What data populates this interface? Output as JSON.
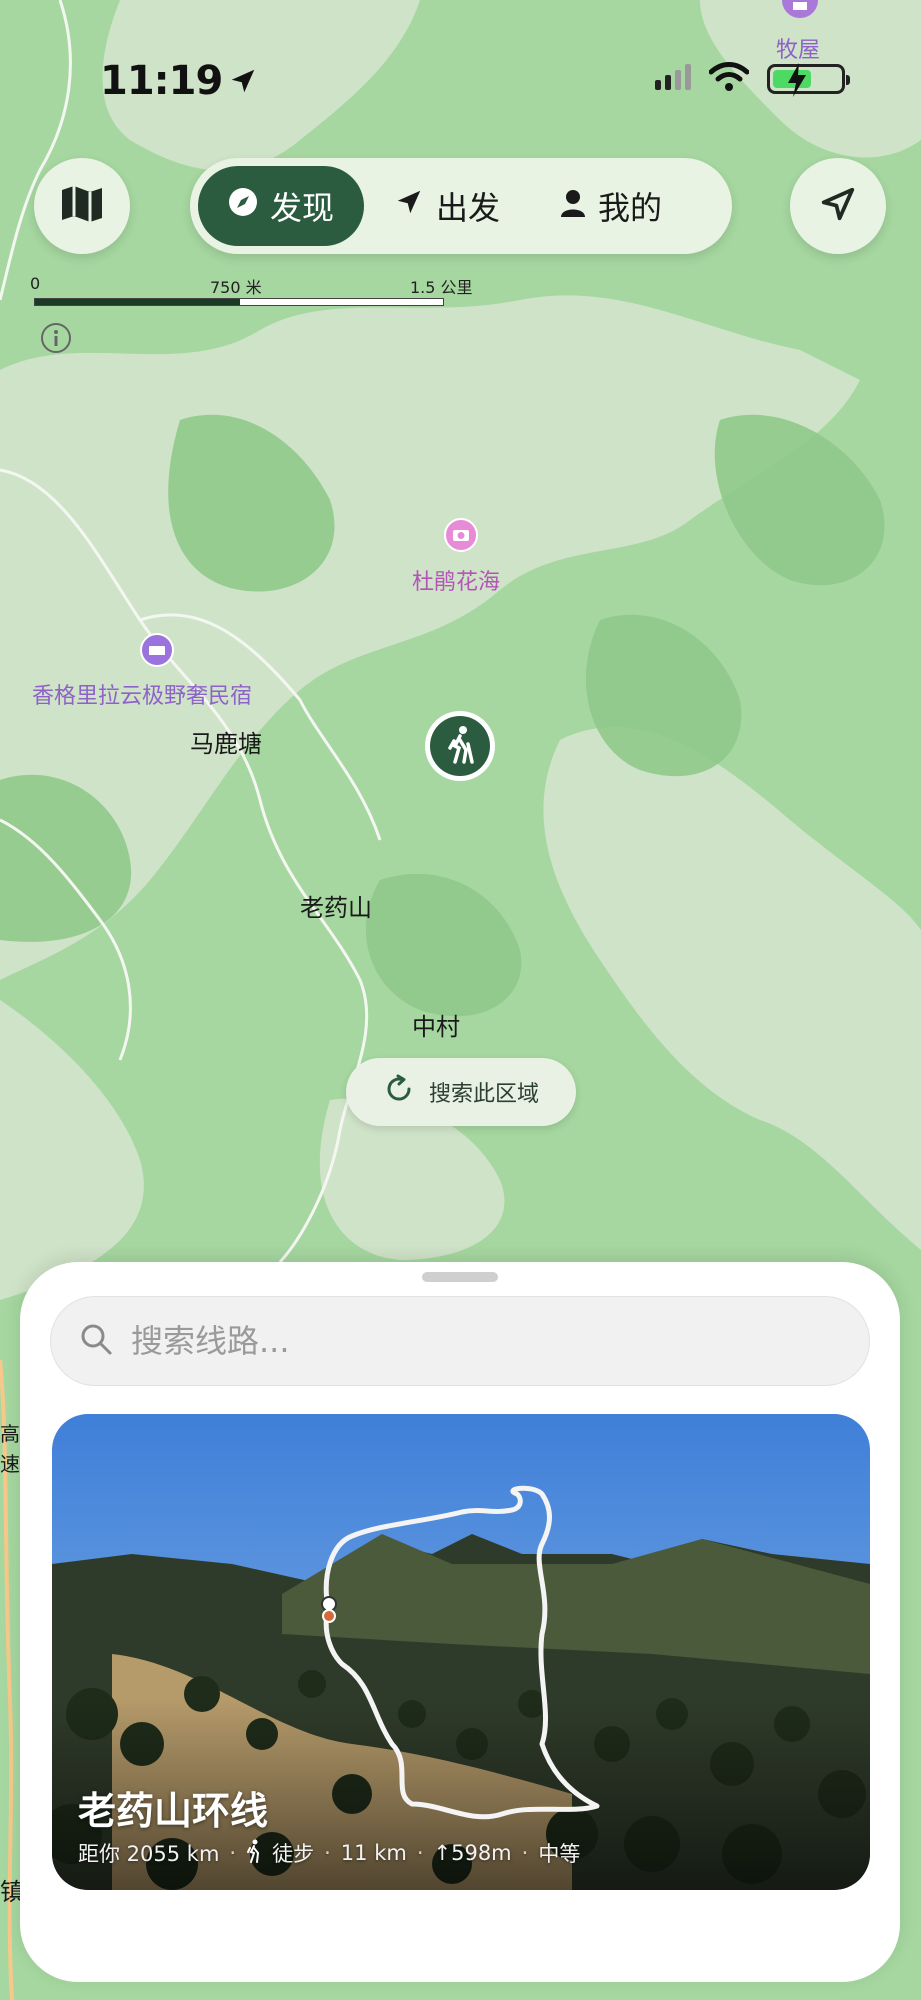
{
  "status": {
    "time": "11:19"
  },
  "topbar": {
    "tabs": [
      {
        "label": "发现",
        "icon": "compass-icon",
        "active": true
      },
      {
        "label": "出发",
        "icon": "navigation-arrow-icon",
        "active": false
      },
      {
        "label": "我的",
        "icon": "person-icon",
        "active": false
      }
    ]
  },
  "scale": {
    "start": "0",
    "mid": "750 米",
    "end": "1.5 公里"
  },
  "map": {
    "poi_hut": "牧屋",
    "poi_flowers": "杜鹃花海",
    "poi_lodge": "香格里拉云极野奢民宿",
    "place_malutang": "马鹿塘",
    "place_laoyaoshan": "老药山",
    "place_zhongcun": "中村",
    "edge_left_1": "高",
    "edge_left_2": "速",
    "edge_left_3": "镇",
    "poi_color": "#b553b9",
    "lodge_color": "#8e62c9",
    "accent": "#2b5c40"
  },
  "search_area_label": "搜索此区域",
  "search": {
    "placeholder": "搜索线路..."
  },
  "route": {
    "title": "老药山环线",
    "distance_from_you": "距你 2055 km",
    "activity": "徒步",
    "length": "11 km",
    "elevation": "↑598m",
    "difficulty": "中等"
  }
}
